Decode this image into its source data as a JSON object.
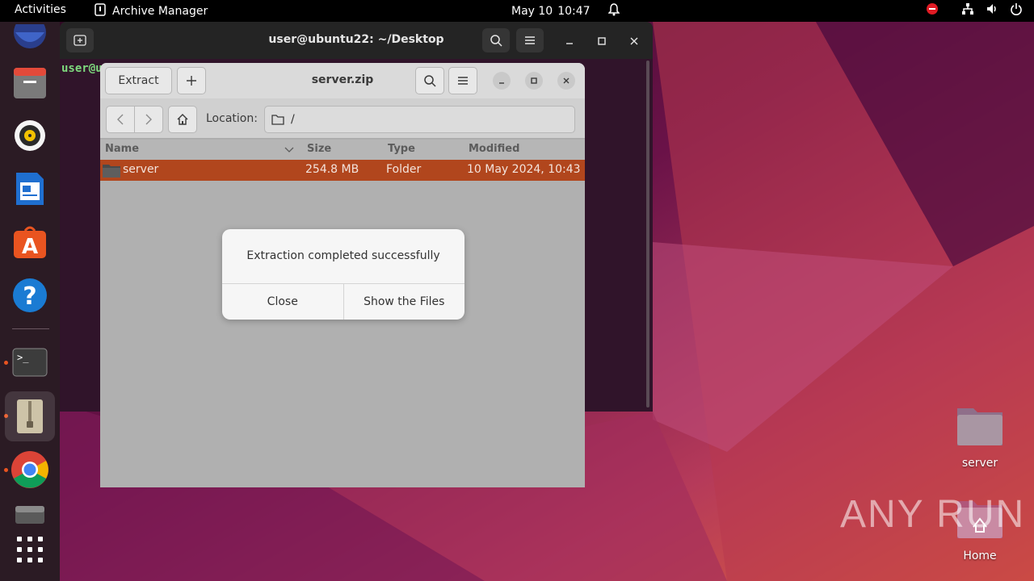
{
  "topbar": {
    "activities": "Activities",
    "app_name": "Archive Manager",
    "date": "May 10",
    "time": "10:47"
  },
  "dock": {
    "items": [
      "firefox",
      "files",
      "rhythmbox",
      "libreoffice-writer",
      "app-center",
      "help",
      "terminal",
      "archive-manager",
      "chrome",
      "disk",
      "show-apps"
    ]
  },
  "terminal": {
    "title": "user@ubuntu22: ~/Desktop",
    "prompt": "user@u"
  },
  "archive": {
    "title": "server.zip",
    "extract_label": "Extract",
    "location_label": "Location:",
    "location_path": "/",
    "columns": {
      "name": "Name",
      "size": "Size",
      "type": "Type",
      "modified": "Modified"
    },
    "rows": [
      {
        "name": "server",
        "size": "254.8 MB",
        "type": "Folder",
        "modified": "10 May 2024, 10:43"
      }
    ]
  },
  "dialog": {
    "message": "Extraction completed successfully",
    "close_label": "Close",
    "show_files_label": "Show the Files"
  },
  "desktop": {
    "icons": [
      {
        "label": "server"
      },
      {
        "label": "Home"
      }
    ],
    "watermark": "ANY RUN"
  },
  "colors": {
    "accent": "#e95420",
    "selection": "#b1461d",
    "topbar": "#000000"
  }
}
